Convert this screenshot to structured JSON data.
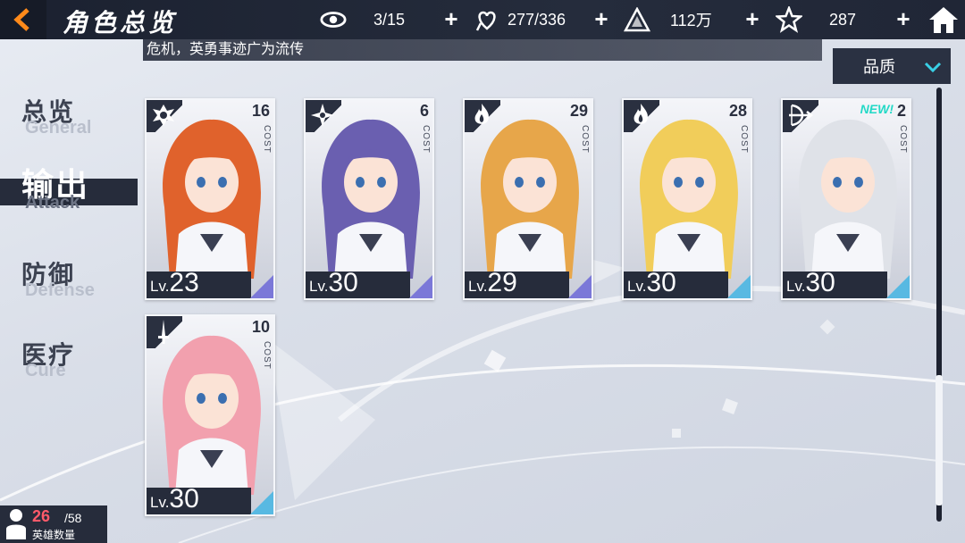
{
  "header": {
    "title": "角色总览",
    "stats": [
      {
        "icon": "eye-icon",
        "value": "3/15"
      },
      {
        "icon": "heart-hand-icon",
        "value": "277/336"
      },
      {
        "icon": "pyramid-token-icon",
        "value": "112万"
      },
      {
        "icon": "star-badge-icon",
        "value": "287"
      }
    ]
  },
  "marquee": {
    "text": "危机，英勇事迹广为流传"
  },
  "sort": {
    "label": "品质"
  },
  "sidebar": {
    "items": [
      {
        "cn": "总览",
        "en": "General",
        "active": false
      },
      {
        "cn": "输出",
        "en": "Attack",
        "active": true
      },
      {
        "cn": "防御",
        "en": "Defense",
        "active": false
      },
      {
        "cn": "医疗",
        "en": "Cure",
        "active": false
      }
    ]
  },
  "cards": [
    {
      "cost": "16",
      "cost_label": "COST",
      "lv_prefix": "Lv.",
      "level": "23",
      "class_icon": "crest-class-icon",
      "accent": "#7b78d8",
      "hair": "#e0622c",
      "new": ""
    },
    {
      "cost": "6",
      "cost_label": "COST",
      "lv_prefix": "Lv.",
      "level": "30",
      "class_icon": "shuriken-class-icon",
      "accent": "#7b78d8",
      "hair": "#6a5fb0",
      "new": ""
    },
    {
      "cost": "29",
      "cost_label": "COST",
      "lv_prefix": "Lv.",
      "level": "29",
      "class_icon": "flame-class-icon",
      "accent": "#7b78d8",
      "hair": "#e7a64a",
      "new": ""
    },
    {
      "cost": "28",
      "cost_label": "COST",
      "lv_prefix": "Lv.",
      "level": "30",
      "class_icon": "flame-class-icon",
      "accent": "#58b9e2",
      "hair": "#f1cd5a",
      "new": ""
    },
    {
      "cost": "2",
      "cost_label": "COST",
      "lv_prefix": "Lv.",
      "level": "30",
      "class_icon": "bow-class-icon",
      "accent": "#58b9e2",
      "hair": "#dfe2e8",
      "new": "NEW!"
    },
    {
      "cost": "10",
      "cost_label": "COST",
      "lv_prefix": "Lv.",
      "level": "30",
      "class_icon": "sword-class-icon",
      "accent": "#58b9e2",
      "hair": "#f2a0ae",
      "new": ""
    }
  ],
  "counter": {
    "current": "26",
    "total": "/58",
    "label": "英雄数量"
  }
}
